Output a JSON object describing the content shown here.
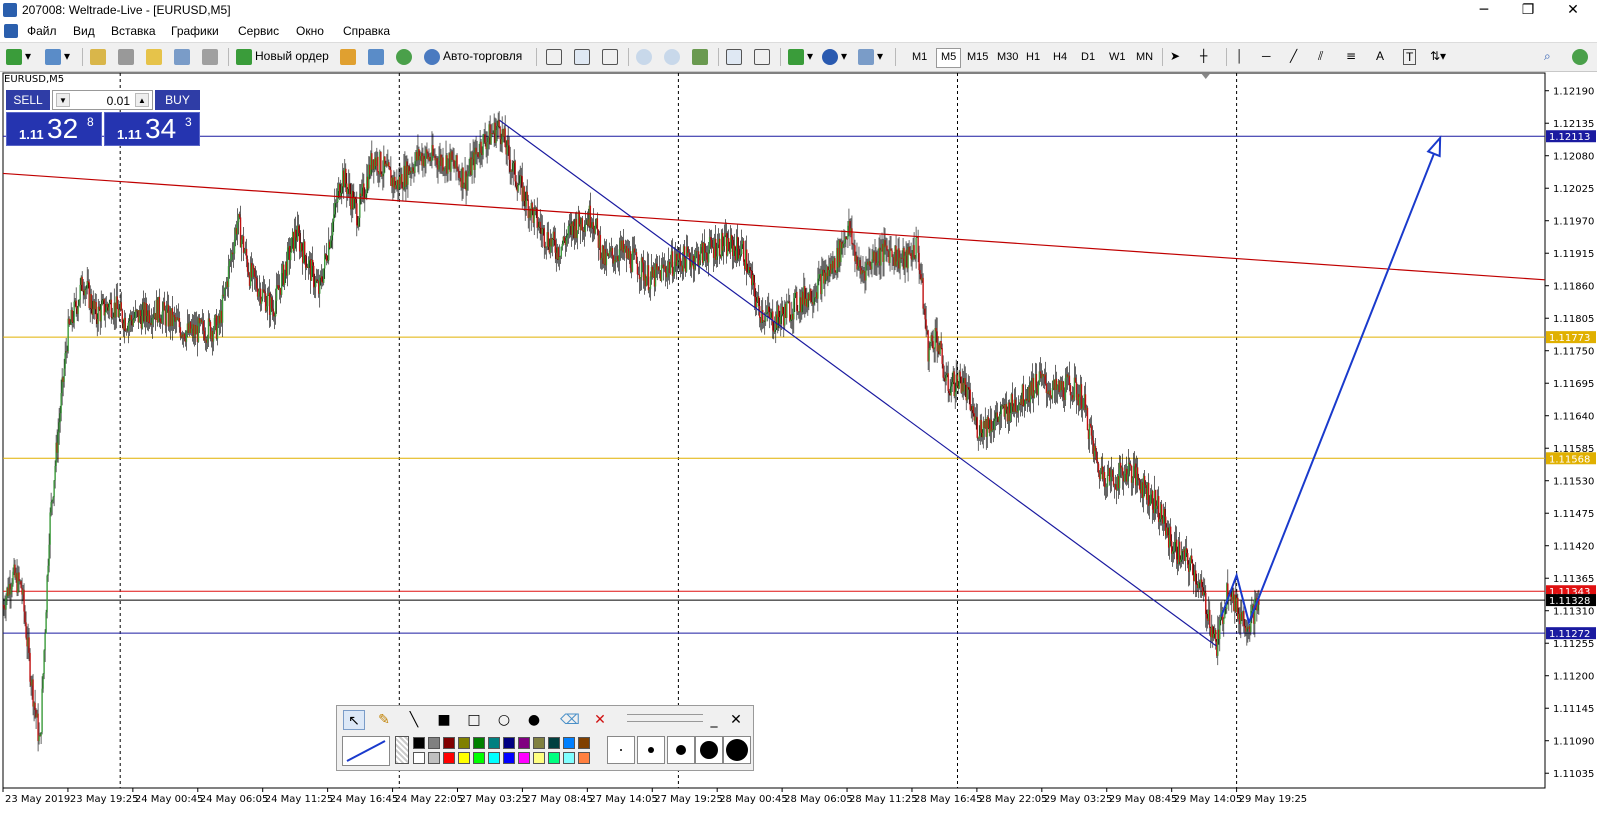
{
  "window": {
    "title": "207008: Weltrade-Live - [EURUSD,M5]",
    "minimize": "─",
    "restore": "❐",
    "close": "✕"
  },
  "menu": [
    "Файл",
    "Вид",
    "Вставка",
    "Графики",
    "Сервис",
    "Окно",
    "Справка"
  ],
  "mdi_controls": [
    "_",
    "❐",
    "✕"
  ],
  "toolbar": {
    "new_order": "Новый ордер",
    "auto_trading": "Авто-торговля",
    "timeframes": [
      "M1",
      "M5",
      "M15",
      "M30",
      "H1",
      "H4",
      "D1",
      "W1",
      "MN"
    ],
    "active_timeframe": "M5",
    "text_tool": "A",
    "text_label_tool": "T"
  },
  "chart": {
    "symbol_label": "EURUSD,M5",
    "one_click": {
      "sell_label": "SELL",
      "buy_label": "BUY",
      "lot": "0.01",
      "bid": {
        "prefix": "1.11",
        "big": "32",
        "sup": "8"
      },
      "ask": {
        "prefix": "1.11",
        "big": "34",
        "sup": "3"
      }
    }
  },
  "chart_data": {
    "type": "candlestick",
    "instrument": "EURUSD",
    "timeframe": "M5",
    "ylim": [
      1.1101,
      1.1222
    ],
    "y_ticks": [
      "1.12190",
      "1.12135",
      "1.12080",
      "1.12025",
      "1.11970",
      "1.11915",
      "1.11860",
      "1.11805",
      "1.11750",
      "1.11695",
      "1.11640",
      "1.11585",
      "1.11530",
      "1.11475",
      "1.11420",
      "1.11365",
      "1.11310",
      "1.11255",
      "1.11200",
      "1.11145",
      "1.11090",
      "1.11035"
    ],
    "x_ticks": [
      "23 May 2019",
      "23 May 19:25",
      "24 May 00:45",
      "24 May 06:05",
      "24 May 11:25",
      "24 May 16:45",
      "24 May 22:05",
      "27 May 03:25",
      "27 May 08:45",
      "27 May 14:05",
      "27 May 19:25",
      "28 May 00:45",
      "28 May 06:05",
      "28 May 11:25",
      "28 May 16:45",
      "28 May 22:05",
      "29 May 03:25",
      "29 May 08:45",
      "29 May 14:05",
      "29 May 19:25"
    ],
    "horizontal_levels": [
      {
        "price": "1.12113",
        "color": "#1a1aa0"
      },
      {
        "price": "1.11773",
        "color": "#e0b000"
      },
      {
        "price": "1.11568",
        "color": "#e0b000"
      },
      {
        "price": "1.11343",
        "color": "#e01010"
      },
      {
        "price": "1.11328",
        "color": "#000000"
      },
      {
        "price": "1.11272",
        "color": "#1a1aa0"
      }
    ],
    "trendlines": [
      {
        "from": [
          0.0,
          1.1205
        ],
        "to": [
          1.0,
          1.1187
        ],
        "color": "#c00000"
      },
      {
        "from": [
          0.322,
          1.1214
        ],
        "to": [
          0.787,
          1.1125
        ],
        "color": "#1a1aa0"
      }
    ],
    "projection": [
      [
        0.79,
        1.113
      ],
      [
        0.8,
        1.1137
      ],
      [
        0.808,
        1.1129
      ],
      [
        0.932,
        1.1211
      ]
    ],
    "price_path": [
      [
        0,
        1.1132
      ],
      [
        0.006,
        1.1137
      ],
      [
        0.012,
        1.1135
      ],
      [
        0.018,
        1.112
      ],
      [
        0.024,
        1.1108
      ],
      [
        0.03,
        1.1145
      ],
      [
        0.036,
        1.1162
      ],
      [
        0.042,
        1.1178
      ],
      [
        0.048,
        1.1183
      ],
      [
        0.052,
        1.1187
      ],
      [
        0.06,
        1.1181
      ],
      [
        0.07,
        1.1183
      ],
      [
        0.08,
        1.118
      ],
      [
        0.1,
        1.1182
      ],
      [
        0.12,
        1.1178
      ],
      [
        0.14,
        1.1179
      ],
      [
        0.152,
        1.1197
      ],
      [
        0.16,
        1.1188
      ],
      [
        0.175,
        1.1182
      ],
      [
        0.19,
        1.1195
      ],
      [
        0.205,
        1.1185
      ],
      [
        0.22,
        1.1205
      ],
      [
        0.23,
        1.1198
      ],
      [
        0.24,
        1.1208
      ],
      [
        0.255,
        1.1203
      ],
      [
        0.27,
        1.1208
      ],
      [
        0.29,
        1.1207
      ],
      [
        0.3,
        1.1204
      ],
      [
        0.31,
        1.121
      ],
      [
        0.322,
        1.1213
      ],
      [
        0.33,
        1.1206
      ],
      [
        0.34,
        1.12
      ],
      [
        0.35,
        1.1195
      ],
      [
        0.36,
        1.1192
      ],
      [
        0.37,
        1.1196
      ],
      [
        0.382,
        1.1198
      ],
      [
        0.39,
        1.119
      ],
      [
        0.4,
        1.1192
      ],
      [
        0.41,
        1.119
      ],
      [
        0.42,
        1.1187
      ],
      [
        0.435,
        1.119
      ],
      [
        0.45,
        1.1191
      ],
      [
        0.465,
        1.1193
      ],
      [
        0.48,
        1.1192
      ],
      [
        0.49,
        1.1182
      ],
      [
        0.5,
        1.118
      ],
      [
        0.51,
        1.1182
      ],
      [
        0.525,
        1.1185
      ],
      [
        0.54,
        1.119
      ],
      [
        0.548,
        1.1196
      ],
      [
        0.556,
        1.1188
      ],
      [
        0.565,
        1.1191
      ],
      [
        0.575,
        1.1192
      ],
      [
        0.585,
        1.119
      ],
      [
        0.593,
        1.1193
      ],
      [
        0.6,
        1.1175
      ],
      [
        0.605,
        1.1178
      ],
      [
        0.612,
        1.1169
      ],
      [
        0.622,
        1.117
      ],
      [
        0.632,
        1.1162
      ],
      [
        0.642,
        1.1163
      ],
      [
        0.652,
        1.1165
      ],
      [
        0.66,
        1.1167
      ],
      [
        0.672,
        1.117
      ],
      [
        0.682,
        1.1168
      ],
      [
        0.692,
        1.1169
      ],
      [
        0.7,
        1.1167
      ],
      [
        0.71,
        1.1155
      ],
      [
        0.72,
        1.1153
      ],
      [
        0.73,
        1.1155
      ],
      [
        0.74,
        1.1152
      ],
      [
        0.75,
        1.1148
      ],
      [
        0.758,
        1.1142
      ],
      [
        0.765,
        1.114
      ],
      [
        0.772,
        1.1138
      ],
      [
        0.78,
        1.1132
      ],
      [
        0.787,
        1.1125
      ],
      [
        0.795,
        1.1136
      ],
      [
        0.8,
        1.1131
      ],
      [
        0.808,
        1.1129
      ],
      [
        0.815,
        1.1133
      ]
    ]
  }
}
